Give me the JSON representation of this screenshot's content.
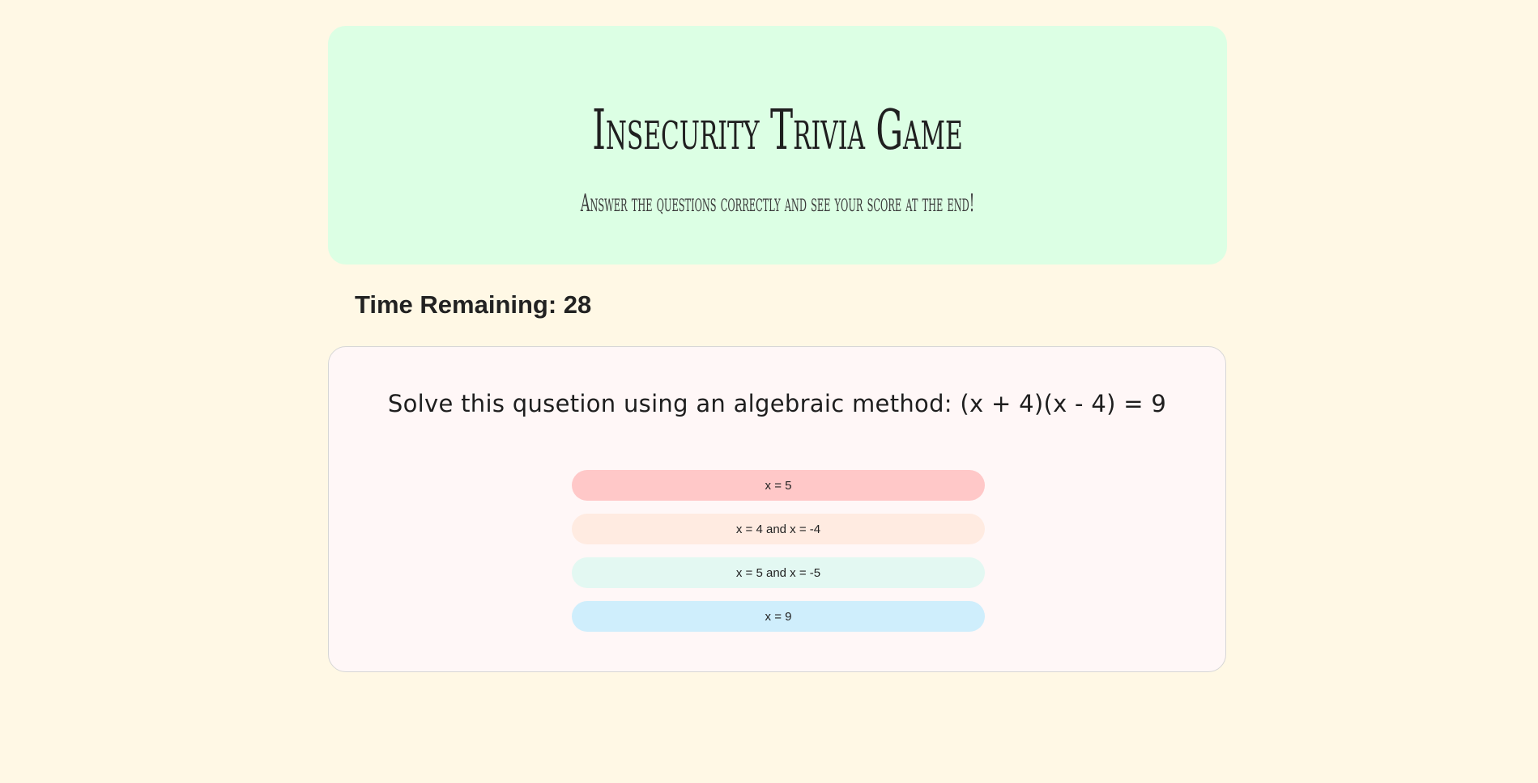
{
  "header": {
    "title": "Insecurity Trivia Game",
    "subtitle": "Answer the questions correctly and see your score at the end!",
    "background_color": "#dcffe4"
  },
  "timer": {
    "label": "Time Remaining: 28",
    "seconds_remaining": 28
  },
  "question": {
    "text": "Solve this qusetion using an algebraic method: (x + 4)(x - 4) = 9",
    "answers": [
      {
        "label": "x = 5",
        "color": "#ffc8c8"
      },
      {
        "label": "x = 4 and x = -4",
        "color": "#ffebe1"
      },
      {
        "label": "x = 5 and x = -5",
        "color": "#e3f8f2"
      },
      {
        "label": "x = 9",
        "color": "#cfeefc"
      }
    ]
  },
  "page": {
    "background_color": "#fff8e5"
  }
}
